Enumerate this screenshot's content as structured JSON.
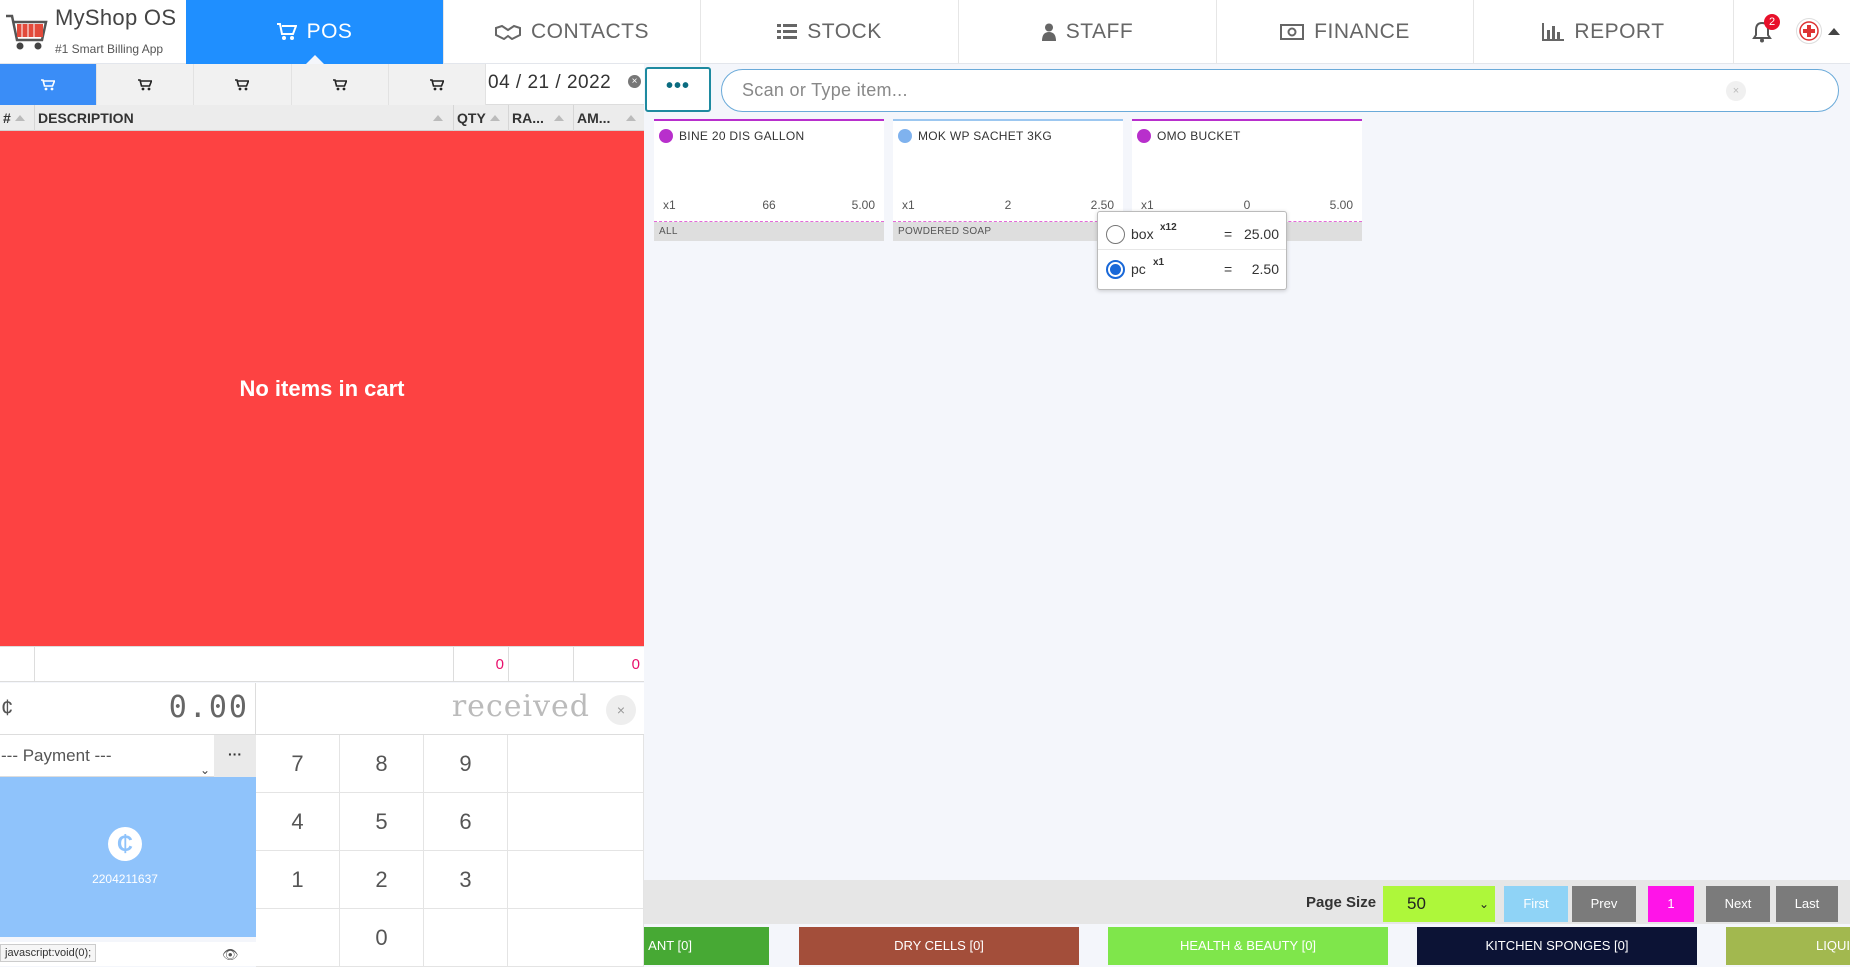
{
  "brand": {
    "name": "MyShop OS",
    "tagline": "#1 Smart Billing App"
  },
  "nav": {
    "tabs": [
      {
        "label": "POS",
        "icon": "cart-icon"
      },
      {
        "label": "CONTACTS",
        "icon": "handshake-icon"
      },
      {
        "label": "STOCK",
        "icon": "list-icon"
      },
      {
        "label": "STAFF",
        "icon": "user-icon"
      },
      {
        "label": "FINANCE",
        "icon": "money-icon"
      },
      {
        "label": "REPORT",
        "icon": "bar-chart-icon"
      }
    ],
    "active_tab": "POS",
    "notifications_count": "2"
  },
  "cart": {
    "tab_count": 5,
    "active_tab_index": 0,
    "date": "04 / 21 / 2022",
    "date_clear": "×",
    "columns": [
      "#",
      "DESCRIPTION",
      "QTY",
      "RA...",
      "AM..."
    ],
    "empty_message": "No items in cart",
    "totals": {
      "qty": "0",
      "amount": "0"
    },
    "currency_symbol": "¢",
    "amount": "0.00",
    "received_placeholder": "received",
    "received_clear": "×",
    "payment_placeholder": "--- Payment ---",
    "payment_caret": "⌄",
    "payment_more": "···",
    "momo_symbol": "₵",
    "momo_number": "2204211637",
    "status_url": "javascript:void(0);",
    "status_eye": "👁",
    "keypad": [
      "7",
      "8",
      "9",
      "4",
      "5",
      "6",
      "1",
      "2",
      "3",
      "0"
    ]
  },
  "search": {
    "menu_label": "•••",
    "placeholder": "Scan or Type item...",
    "clear": "×"
  },
  "items": [
    {
      "name": "BINE 20 DIS GALLON",
      "unit": "x1",
      "stock": "66",
      "price": "5.00",
      "category": "ALL",
      "dot_color": "#b82fcc",
      "border_color": "#b82fcc"
    },
    {
      "name": "MOK WP SACHET 3KG",
      "unit": "x1",
      "stock": "2",
      "price": "2.50",
      "category": "POWDERED SOAP",
      "dot_color": "#7fb2ee",
      "border_color": "#9cc7f0"
    },
    {
      "name": "OMO BUCKET",
      "unit": "x1",
      "stock": "0",
      "price": "5.00",
      "category": "",
      "dot_color": "#b82fcc",
      "border_color": "#b82fcc"
    }
  ],
  "unit_popover": {
    "options": [
      {
        "name": "box",
        "multiplier": "x12",
        "eq": "=",
        "price": "25.00",
        "selected": false
      },
      {
        "name": "pc",
        "multiplier": "x1",
        "eq": "=",
        "price": "2.50",
        "selected": true
      }
    ]
  },
  "pagination": {
    "page_size_label": "Page Size",
    "page_size": "50",
    "page_size_caret": "⌄",
    "first": "First",
    "prev": "Prev",
    "current": "1",
    "next": "Next",
    "last": "Last"
  },
  "categories": [
    {
      "label": "ANT [0]",
      "color": "#47a934"
    },
    {
      "label": "DRY CELLS [0]",
      "color": "#a34e3a"
    },
    {
      "label": "HEALTH & BEAUTY [0]",
      "color": "#7fe64b"
    },
    {
      "label": "KITCHEN SPONGES [0]",
      "color": "#0c1335"
    },
    {
      "label": "LIQUI",
      "color": "#a2b84f"
    }
  ],
  "colors": {
    "accent_blue": "#1f8fff",
    "cart_empty_red": "#fd4242",
    "momo_blue": "#8fc3fb",
    "page_size_green": "#aef73a",
    "current_page_magenta": "#ff14e8"
  }
}
